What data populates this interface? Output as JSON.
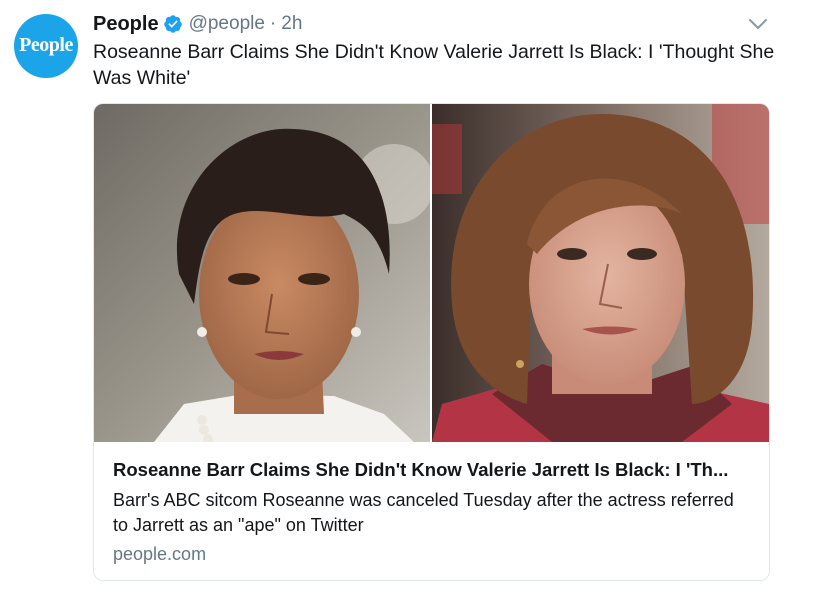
{
  "account": {
    "avatar_text": "People",
    "display_name": "People",
    "handle": "@people",
    "separator": "·",
    "time": "2h"
  },
  "tweet": {
    "text": "Roseanne Barr Claims She Didn't Know Valerie Jarrett Is Black: I 'Thought She Was White'"
  },
  "card": {
    "title": "Roseanne Barr Claims She Didn't Know Valerie Jarrett Is Black: I 'Th...",
    "description": "Barr's ABC sitcom Roseanne was canceled Tuesday after the actress referred to Jarrett as an \"ape\" on Twitter",
    "domain": "people.com"
  },
  "colors": {
    "brand": "#1ba4e8",
    "verified": "#1da1f2",
    "muted": "#657786",
    "border": "#e1e8ed"
  },
  "icons": {
    "verified": "verified-badge-icon",
    "caret": "chevron-down-icon"
  }
}
